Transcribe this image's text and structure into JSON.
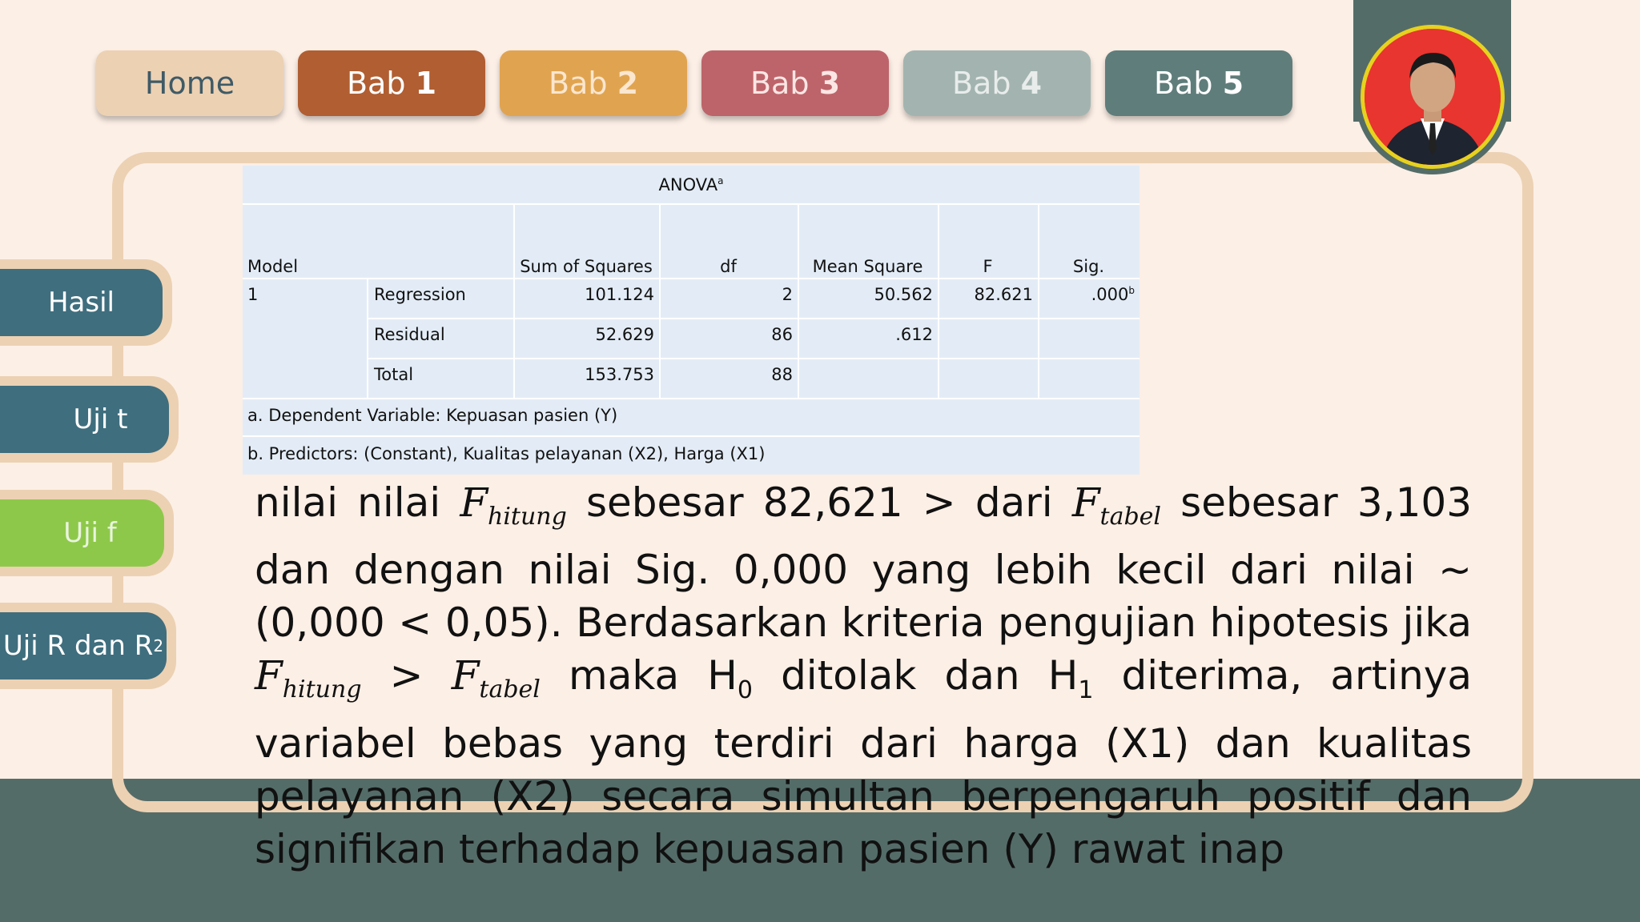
{
  "colors": {
    "background": "#fcefe6",
    "band": "#546c68",
    "frame": "#ecd1b3",
    "home": "#ecd1b3",
    "bab1": "#b05e32",
    "bab2": "#e0a450",
    "bab3": "#bd646a",
    "bab4": "#a3b4b0",
    "bab5": "#5f7d7b",
    "side_teal": "#3f6e7e",
    "side_green": "#8ec84a"
  },
  "nav": {
    "home": "Home",
    "bab_word": "Bab",
    "bab1": "1",
    "bab2": "2",
    "bab3": "3",
    "bab4": "4",
    "bab5": "5"
  },
  "side": {
    "hasil": "Hasil",
    "ujit": "Uji t",
    "ujif": "Uji f",
    "ujir": "Uji R dan R",
    "ujir_sup": "2"
  },
  "anova": {
    "title": "ANOVA",
    "title_sup": "a",
    "headers": {
      "model": "Model",
      "ss": "Sum of Squares",
      "df": "df",
      "ms": "Mean Square",
      "f": "F",
      "sig": "Sig."
    },
    "model_no": "1",
    "rows": [
      {
        "label": "Regression",
        "ss": "101.124",
        "df": "2",
        "ms": "50.562",
        "f": "82.621",
        "sig": ".000",
        "sig_sup": "b"
      },
      {
        "label": "Residual",
        "ss": "52.629",
        "df": "86",
        "ms": ".612",
        "f": "",
        "sig": "",
        "sig_sup": ""
      },
      {
        "label": "Total",
        "ss": "153.753",
        "df": "88",
        "ms": "",
        "f": "",
        "sig": "",
        "sig_sup": ""
      }
    ],
    "note_a": "a. Dependent Variable: Kepuasan pasien (Y)",
    "note_b": "b. Predictors: (Constant), Kualitas pelayanan (X2), Harga (X1)"
  },
  "paragraph": {
    "t1": "nilai nilai ",
    "F": "F",
    "hitung": "hitung",
    "tabel": "tabel",
    "t2": " sebesar 82,621 > dari ",
    "t3": " sebesar 3,103 dan dengan nilai Sig. 0,000 yang lebih kecil dari nilai ",
    "alpha": "~",
    "t4": " (0,000 < 0,05). Berdasarkan kriteria pengujian hipotesis jika ",
    "t5": " > ",
    "t6": " maka H",
    "h0": "0",
    "t7": " ditolak dan H",
    "h1": "1",
    "t8": " diterima, artinya variabel bebas yang terdiri dari harga (X1) dan kualitas pelayanan (X2) secara simultan berpengaruh positif dan signifikan terhadap kepuasan pasien (Y) rawat inap"
  }
}
